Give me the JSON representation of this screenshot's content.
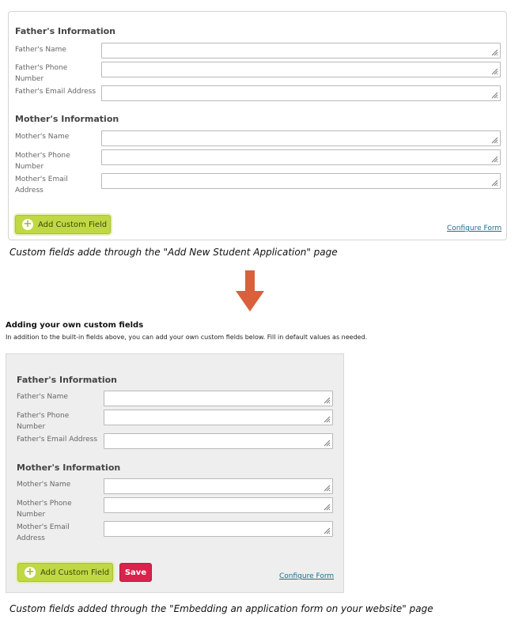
{
  "form_top": {
    "father_section_title": "Father's Information",
    "father_name_label": "Father's Name",
    "father_phone_label_line1": "Father's Phone",
    "father_phone_label_line2": "Number",
    "father_email_label": "Father's Email Address",
    "mother_section_title": "Mother's Information",
    "mother_name_label": "Mother's Name",
    "mother_phone_label_line1": "Mother's Phone",
    "mother_phone_label_line2": "Number",
    "mother_email_label_line1": "Mother's Email",
    "mother_email_label_line2": "Address",
    "add_custom_field_label": "Add Custom Field",
    "configure_form_label": "Configure Form"
  },
  "caption_top": "Custom fields adde through the \"Add New Student Application\" page",
  "arrow": {
    "icon": "arrow-down-icon",
    "color": "#d9603b"
  },
  "embed_section": {
    "heading": "Adding your own custom fields",
    "intro": "In addition to the built-in fields above, you can add your own custom fields below. Fill in default values as needed."
  },
  "form_bottom": {
    "father_section_title": "Father's Information",
    "father_name_label": "Father's Name",
    "father_phone_label_line1": "Father's Phone",
    "father_phone_label_line2": "Number",
    "father_email_label": "Father's Email Address",
    "mother_section_title": "Mother's Information",
    "mother_name_label": "Mother's Name",
    "mother_phone_label_line1": "Mother's Phone",
    "mother_phone_label_line2": "Number",
    "mother_email_label_line1": "Mother's Email",
    "mother_email_label_line2": "Address",
    "add_custom_field_label": "Add Custom Field",
    "save_label": "Save",
    "configure_form_label": "Configure Form"
  },
  "caption_bottom": "Custom fields added through the \"Embedding an application form on your website\" page",
  "colors": {
    "add_button": "#c1d845",
    "save_button": "#d9224c",
    "link": "#1d6e8f"
  }
}
